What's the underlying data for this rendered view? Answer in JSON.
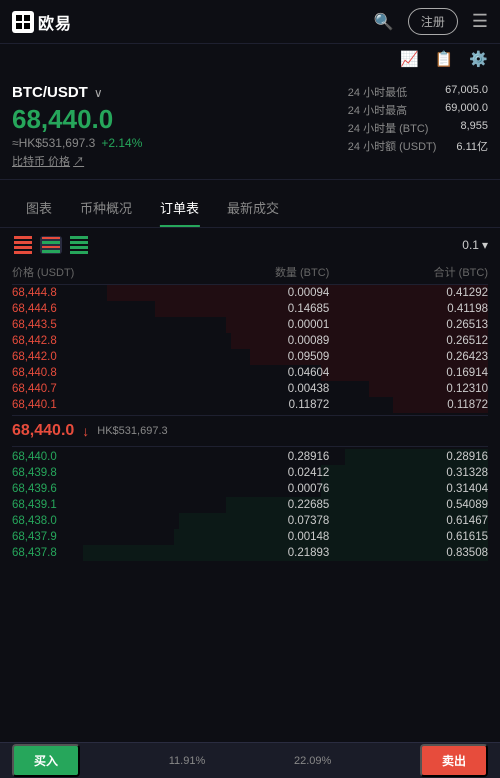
{
  "header": {
    "logo_text": "欧易",
    "register_label": "注册",
    "menu_label": "≡"
  },
  "pair": {
    "name": "BTC/USDT",
    "arrow": "∨"
  },
  "price": {
    "main": "68,440.0",
    "hk": "≈HK$531,697.3",
    "change": "+2.14%",
    "coin_label": "比特币 价格",
    "external_icon": "↗"
  },
  "stats": {
    "low_label": "24 小时最低",
    "low_val": "67,005.0",
    "high_label": "24 小时最高",
    "high_val": "69,000.0",
    "vol_btc_label": "24 小时量 (BTC)",
    "vol_btc_val": "8,955",
    "vol_usdt_label": "24 小时额 (USDT)",
    "vol_usdt_val": "6.11亿"
  },
  "tabs": [
    {
      "label": "图表",
      "active": false
    },
    {
      "label": "币种概况",
      "active": false
    },
    {
      "label": "订单表",
      "active": true
    },
    {
      "label": "最新成交",
      "active": false
    }
  ],
  "orderbook": {
    "decimal": "0.1",
    "col_headers": [
      "价格 (USDT)",
      "数量 (BTC)",
      "合计 (BTC)"
    ],
    "sell_orders": [
      {
        "price": "68,444.8",
        "qty": "0.00094",
        "total": "0.41292",
        "bar_pct": 80
      },
      {
        "price": "68,444.6",
        "qty": "0.14685",
        "total": "0.41198",
        "bar_pct": 70
      },
      {
        "price": "68,443.5",
        "qty": "0.00001",
        "total": "0.26513",
        "bar_pct": 55
      },
      {
        "price": "68,442.8",
        "qty": "0.00089",
        "total": "0.26512",
        "bar_pct": 54
      },
      {
        "price": "68,442.0",
        "qty": "0.09509",
        "total": "0.26423",
        "bar_pct": 50
      },
      {
        "price": "68,440.8",
        "qty": "0.04604",
        "total": "0.16914",
        "bar_pct": 35
      },
      {
        "price": "68,440.7",
        "qty": "0.00438",
        "total": "0.12310",
        "bar_pct": 25
      },
      {
        "price": "68,440.1",
        "qty": "0.11872",
        "total": "0.11872",
        "bar_pct": 20
      }
    ],
    "mid_price": "68,440.0",
    "mid_hk": "HK$531,697.3",
    "mid_direction": "↓",
    "buy_orders": [
      {
        "price": "68,440.0",
        "qty": "0.28916",
        "total": "0.28916",
        "bar_pct": 30
      },
      {
        "price": "68,439.8",
        "qty": "0.02412",
        "total": "0.31328",
        "bar_pct": 35
      },
      {
        "price": "68,439.6",
        "qty": "0.00076",
        "total": "0.31404",
        "bar_pct": 35
      },
      {
        "price": "68,439.1",
        "qty": "0.22685",
        "total": "0.54089",
        "bar_pct": 55
      },
      {
        "price": "68,438.0",
        "qty": "0.07378",
        "total": "0.61467",
        "bar_pct": 65
      },
      {
        "price": "68,437.9",
        "qty": "0.00148",
        "total": "0.61615",
        "bar_pct": 66
      },
      {
        "price": "68,437.8",
        "qty": "0.21893",
        "total": "0.83508",
        "bar_pct": 85
      }
    ]
  },
  "bottom": {
    "buy_label": "买入",
    "sell_label": "卖出",
    "buy_pct": "11.91%",
    "sell_pct": "22.09%"
  }
}
